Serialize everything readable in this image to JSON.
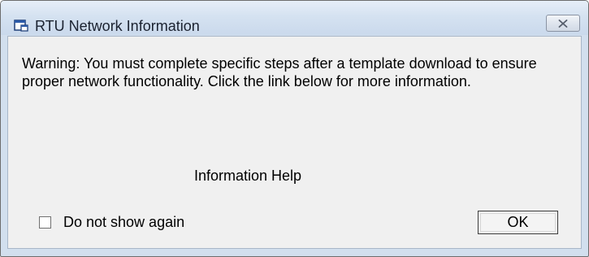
{
  "window": {
    "title": "RTU Network Information",
    "icon": "app-window-icon",
    "close_icon": "close-icon"
  },
  "dialog": {
    "warning_text": "Warning: You must complete specific steps after a template download to ensure proper network functionality. Click the link below for more information.",
    "help_link_label": "Information Help",
    "checkbox_label": "Do not show again",
    "checkbox_checked": false,
    "ok_label": "OK"
  },
  "colors": {
    "frame": "#d2dfee",
    "client_background": "#f0f0f0",
    "text": "#000000"
  }
}
